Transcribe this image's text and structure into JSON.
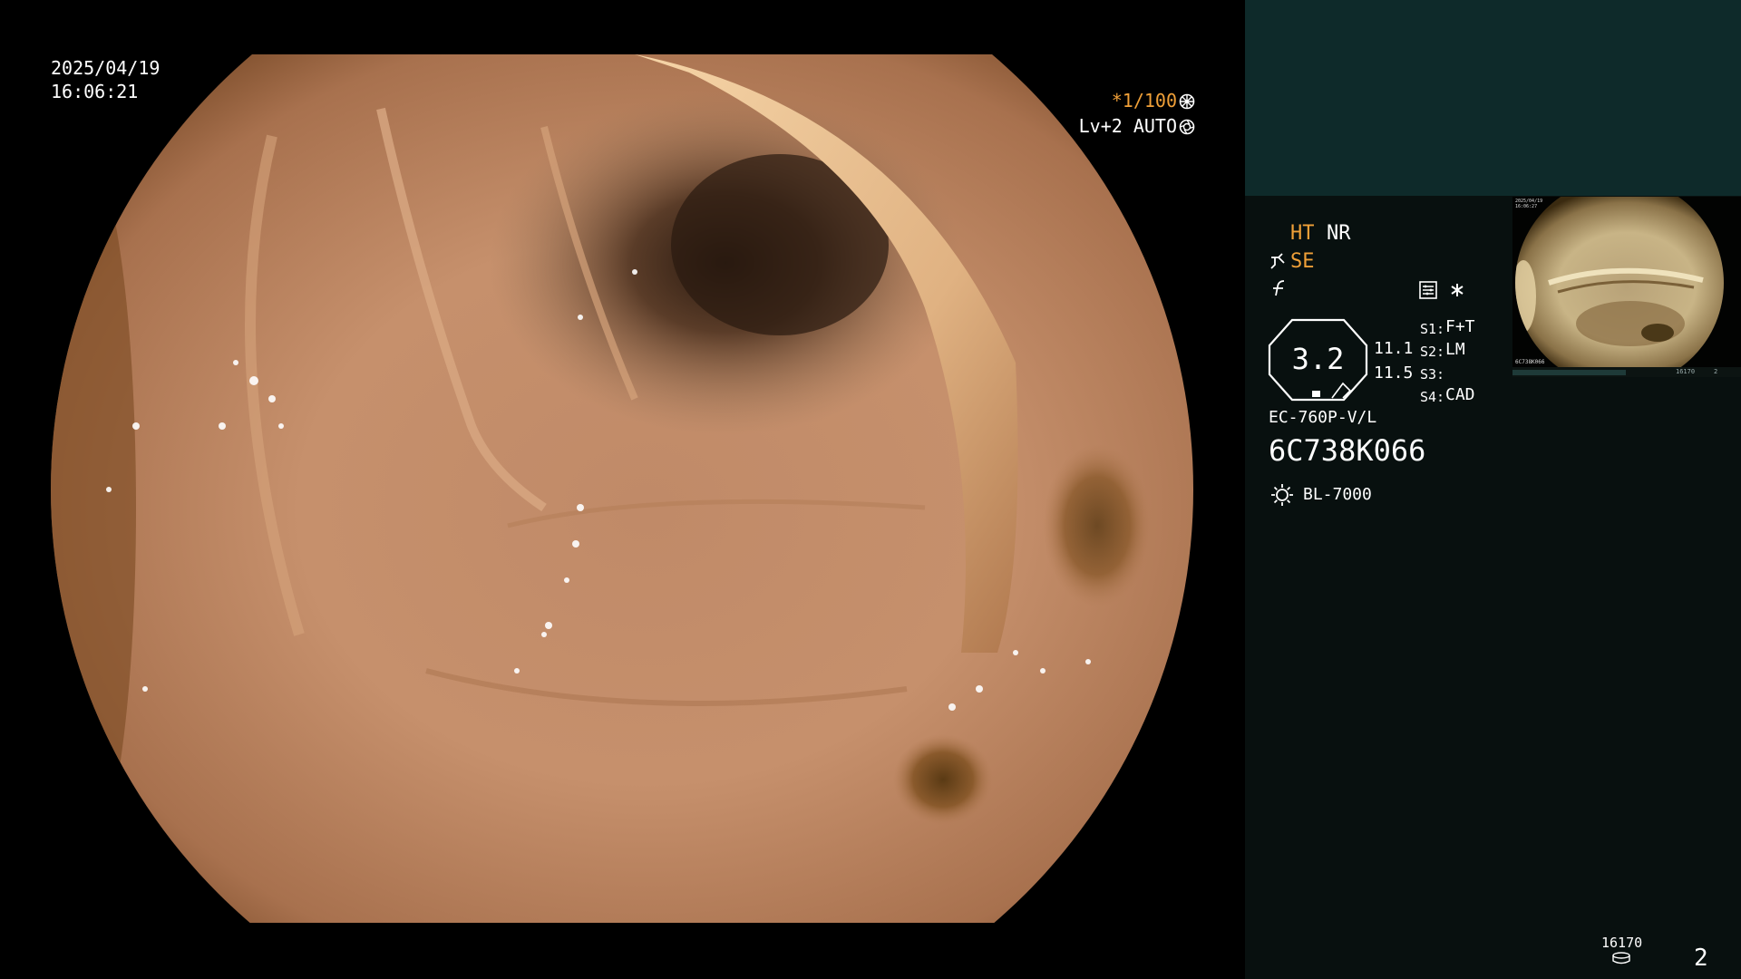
{
  "overlay": {
    "date": "2025/04/19",
    "time": "16:06:21",
    "shutter": "*1/100",
    "level": "Lv+2 AUTO"
  },
  "panel": {
    "ht": "HT",
    "nr": "NR",
    "se": "SE",
    "zoom_value": "3.2",
    "row1_value": "11.1",
    "row2_value": "11.5",
    "s1_key": "S1:",
    "s1_val": "F+T",
    "s2_key": "S2:",
    "s2_val": "LM",
    "s3_key": "S3:",
    "s3_val": "",
    "s4_key": "S4:",
    "s4_val": "CAD",
    "scope_model": "EC-760P-V/L",
    "serial": "6C738K066",
    "light_source": "BL-7000",
    "storage_count": "16170",
    "page_number": "2"
  },
  "thumbnail": {
    "date": "2025/04/19",
    "time": "16:06:27",
    "serial": "6C738K066",
    "count": "16170",
    "page": "2"
  },
  "icons": {
    "shutter_icon": "aperture-icon",
    "level_icon": "iris-icon",
    "se_icon": "scope-tip-icon",
    "nr_icon": "lightning-icon",
    "memory_icon": "memory-card-icon",
    "asterisk_icon": "asterisk-icon",
    "lamp_icon": "sun-lamp-icon",
    "storage_icon": "disk-icon"
  },
  "colors": {
    "accent_orange": "#f0a038",
    "panel_top": "#0e2a2a",
    "panel_bg": "#08100f"
  }
}
